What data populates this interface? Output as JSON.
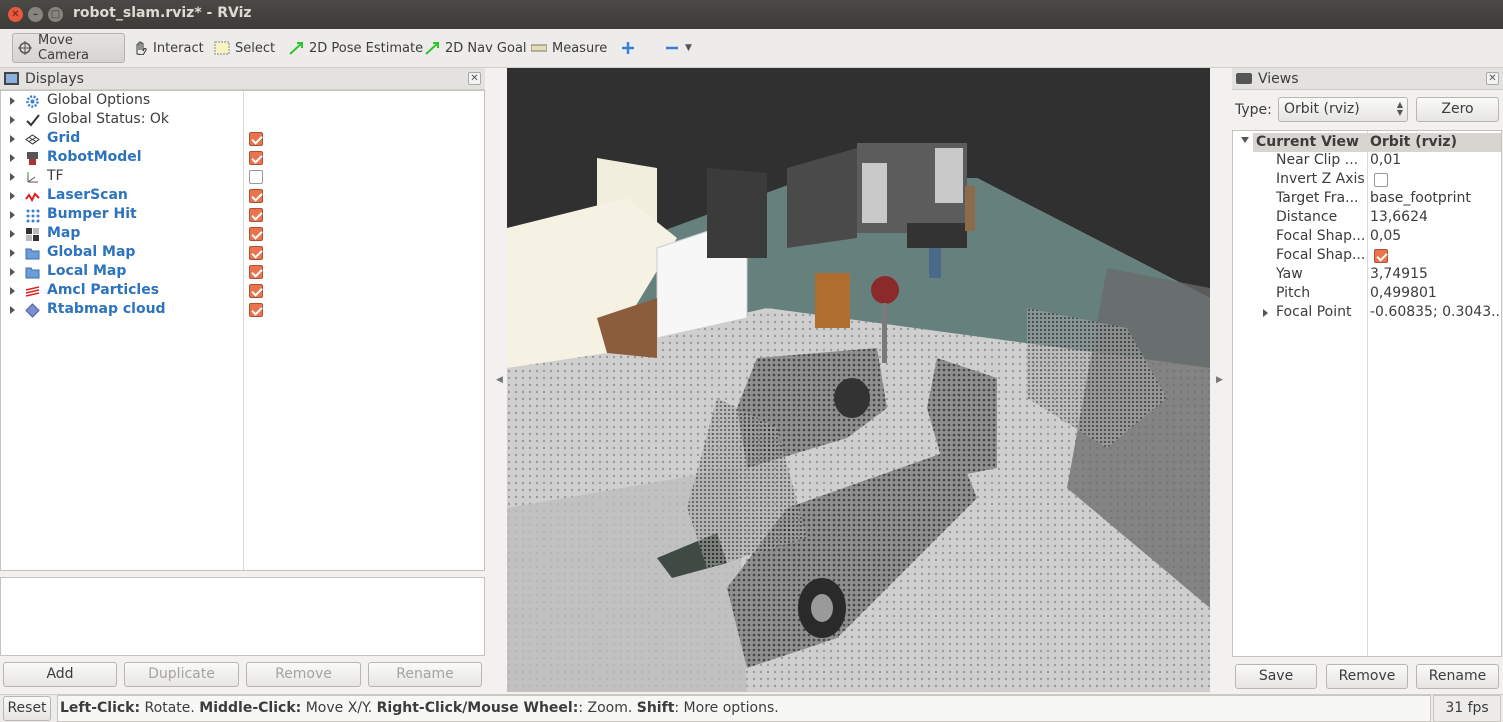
{
  "window": {
    "title": "robot_slam.rviz* - RViz"
  },
  "toolbar": {
    "move_camera": "Move Camera",
    "interact": "Interact",
    "select": "Select",
    "pose_estimate": "2D Pose Estimate",
    "nav_goal": "2D Nav Goal",
    "measure": "Measure"
  },
  "displays": {
    "title": "Displays",
    "items": [
      {
        "label": "Global Options",
        "icon": "gear-icon",
        "checked": null,
        "style": "plain"
      },
      {
        "label": "Global Status: Ok",
        "icon": "checkmark-icon",
        "checked": null,
        "style": "plain"
      },
      {
        "label": "Grid",
        "icon": "grid-icon",
        "checked": true,
        "style": "blue"
      },
      {
        "label": "RobotModel",
        "icon": "robot-icon",
        "checked": true,
        "style": "blue"
      },
      {
        "label": "TF",
        "icon": "axes-icon",
        "checked": false,
        "style": "plain"
      },
      {
        "label": "LaserScan",
        "icon": "laser-icon",
        "checked": true,
        "style": "blue"
      },
      {
        "label": "Bumper Hit",
        "icon": "dots-icon",
        "checked": true,
        "style": "blue"
      },
      {
        "label": "Map",
        "icon": "map-icon",
        "checked": true,
        "style": "blue"
      },
      {
        "label": "Global Map",
        "icon": "folder-icon",
        "checked": true,
        "style": "blue"
      },
      {
        "label": "Local Map",
        "icon": "folder-icon",
        "checked": true,
        "style": "blue"
      },
      {
        "label": "Amcl Particles",
        "icon": "particles-icon",
        "checked": true,
        "style": "blue"
      },
      {
        "label": "Rtabmap cloud",
        "icon": "diamond-icon",
        "checked": true,
        "style": "blue"
      }
    ],
    "buttons": {
      "add": "Add",
      "duplicate": "Duplicate",
      "remove": "Remove",
      "rename": "Rename"
    }
  },
  "views": {
    "title": "Views",
    "type_label": "Type:",
    "type_value": "Orbit (rviz)",
    "zero": "Zero",
    "header_key": "Current View",
    "header_value": "Orbit (rviz)",
    "properties": [
      {
        "key": "Near Clip ...",
        "value": "0,01"
      },
      {
        "key": "Invert Z Axis",
        "value": "",
        "checkbox": false
      },
      {
        "key": "Target Fra...",
        "value": "base_footprint"
      },
      {
        "key": "Distance",
        "value": "13,6624"
      },
      {
        "key": "Focal Shap...",
        "value": "0,05"
      },
      {
        "key": "Focal Shap...",
        "value": "",
        "checkbox": true
      },
      {
        "key": "Yaw",
        "value": "3,74915"
      },
      {
        "key": "Pitch",
        "value": "0,499801"
      },
      {
        "key": "Focal Point",
        "value": "-0.60835; 0.3043...",
        "expandable": true
      }
    ],
    "buttons": {
      "save": "Save",
      "remove": "Remove",
      "rename": "Rename"
    }
  },
  "status": {
    "reset": "Reset",
    "lc": "Left-Click:",
    "lc_t": " Rotate. ",
    "mc": "Middle-Click:",
    "mc_t": " Move X/Y. ",
    "rc": "Right-Click/Mouse Wheel:",
    "rc_t": ": Zoom. ",
    "sh": "Shift",
    "sh_t": ": More options.",
    "fps": "31 fps"
  },
  "colors": {
    "accent_blue": "#2e73be",
    "checkbox_orange": "#e9744f",
    "title_bar": "#3c3b37"
  }
}
